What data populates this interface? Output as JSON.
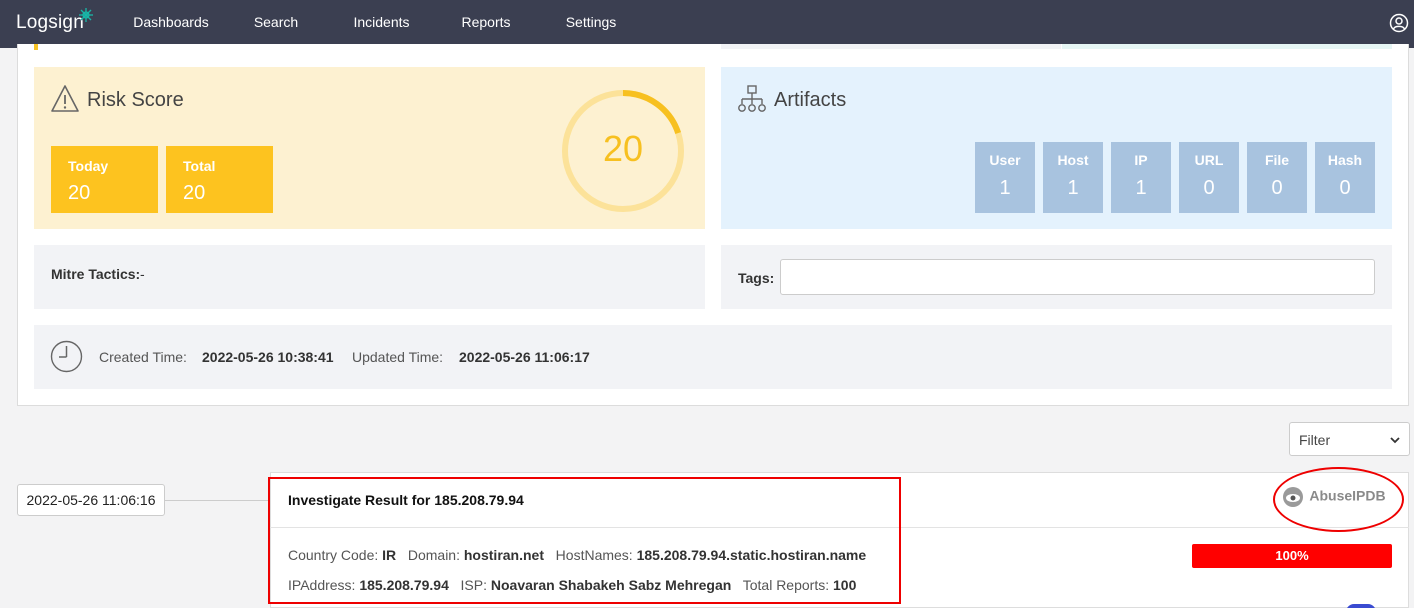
{
  "nav": {
    "logo": "Logsign",
    "items": [
      {
        "label": "Dashboards",
        "active": false
      },
      {
        "label": "Search",
        "active": false
      },
      {
        "label": "Incidents",
        "active": true
      },
      {
        "label": "Reports",
        "active": false
      },
      {
        "label": "Settings",
        "active": false
      }
    ],
    "user_icon": "user-circle-icon"
  },
  "risk": {
    "title": "Risk Score",
    "icon": "warning-triangle-icon",
    "today_label": "Today",
    "today_value": "20",
    "total_label": "Total",
    "total_value": "20",
    "gauge_value": "20",
    "gauge_fraction": 0.2,
    "color": "#fdc31f"
  },
  "artifacts": {
    "title": "Artifacts",
    "icon": "hierarchy-icon",
    "items": [
      {
        "label": "User",
        "value": "1"
      },
      {
        "label": "Host",
        "value": "1"
      },
      {
        "label": "IP",
        "value": "1"
      },
      {
        "label": "URL",
        "value": "0"
      },
      {
        "label": "File",
        "value": "0"
      },
      {
        "label": "Hash",
        "value": "0"
      }
    ]
  },
  "mitre": {
    "label": "Mitre Tactics:",
    "value": "-"
  },
  "tags": {
    "label": "Tags:",
    "value": ""
  },
  "times": {
    "created_label": "Created Time:",
    "created_value": "2022-05-26 10:38:41",
    "updated_label": "Updated Time:",
    "updated_value": "2022-05-26 11:06:17"
  },
  "filter": {
    "selected": "Filter"
  },
  "timeline": {
    "timestamp": "2022-05-26 11:06:16",
    "title": "Investigate Result for 185.208.79.94",
    "source_logo": "AbuseIPDB",
    "country_label": "Country Code:",
    "country_value": "IR",
    "domain_label": "Domain:",
    "domain_value": "hostiran.net",
    "hostnames_label": "HostNames:",
    "hostnames_value": "185.208.79.94.static.hostiran.name",
    "ip_label": "IPAddress:",
    "ip_value": "185.208.79.94",
    "isp_label": "ISP:",
    "isp_value": "Noavaran Shabakeh Sabz Mehregan",
    "reports_label": "Total Reports:",
    "reports_value": "100",
    "confidence_text": "100%",
    "confidence_fraction": 1.0,
    "confidence_color": "#ff0000"
  }
}
